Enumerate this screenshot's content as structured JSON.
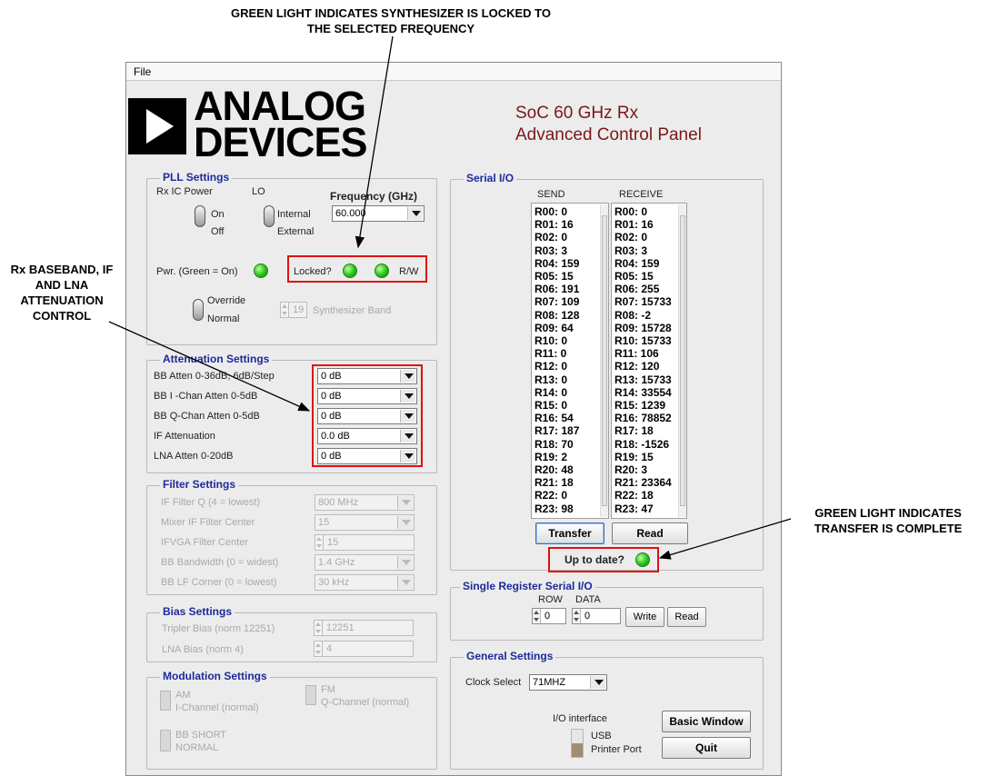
{
  "callouts": {
    "top": "GREEN LIGHT INDICATES SYNTHESIZER IS LOCKED TO THE SELECTED FREQUENCY",
    "left": "Rx BASEBAND, IF AND LNA ATTENUATION CONTROL",
    "right": "GREEN LIGHT INDICATES TRANSFER IS COMPLETE"
  },
  "menu": {
    "file": "File"
  },
  "logo": {
    "line1": "ANALOG",
    "line2": "DEVICES"
  },
  "app_title": {
    "line1": "SoC  60 GHz Rx",
    "line2": "Advanced Control Panel"
  },
  "pll": {
    "title": "PLL Settings",
    "rx_ic_power": "Rx IC Power",
    "lo": "LO",
    "frequency_label": "Frequency (GHz)",
    "frequency_value": "60.000",
    "on": "On",
    "off": "Off",
    "internal": "Internal",
    "external": "External",
    "pwr_label": "Pwr. (Green = On)",
    "locked_label": "Locked?",
    "rw_label": "R/W",
    "override": "Override",
    "normal": "Normal",
    "synth_band_value": "19",
    "synth_band_label": "Synthesizer Band"
  },
  "atten": {
    "title": "Attenuation Settings",
    "rows": [
      {
        "label": "BB Atten 0-36dB, 6dB/Step",
        "value": "0 dB"
      },
      {
        "label": "BB I -Chan Atten 0-5dB",
        "value": "0 dB"
      },
      {
        "label": "BB Q-Chan Atten 0-5dB",
        "value": "0 dB"
      },
      {
        "label": "IF Attenuation",
        "value": "0.0 dB"
      },
      {
        "label": "LNA Atten 0-20dB",
        "value": "0 dB"
      }
    ]
  },
  "filter": {
    "title": "Filter Settings",
    "rows": [
      {
        "label": "IF Filter Q (4 = lowest)",
        "value": "800 MHz"
      },
      {
        "label": "Mixer IF Filter Center",
        "value": "15"
      },
      {
        "label": "IFVGA Filter Center",
        "value": "15"
      },
      {
        "label": "BB Bandwidth (0 = widest)",
        "value": "1.4 GHz"
      },
      {
        "label": "BB LF Corner (0 = lowest)",
        "value": "30 kHz"
      }
    ]
  },
  "bias": {
    "title": "Bias Settings",
    "tripler_label": "Tripler Bias (norm 12251)",
    "tripler_value": "12251",
    "lna_label": "LNA Bias (norm 4)",
    "lna_value": "4"
  },
  "modulation": {
    "title": "Modulation Settings",
    "am": "AM",
    "i_channel": "I-Channel (normal)",
    "fm": "FM",
    "q_channel": "Q-Channel (normal)",
    "bb_short": "BB SHORT",
    "normal": "NORMAL"
  },
  "serial": {
    "title": "Serial I/O",
    "send_header": "SEND",
    "receive_header": "RECEIVE",
    "send": [
      "R00: 0",
      "R01: 16",
      "R02: 0",
      "R03: 3",
      "R04: 159",
      "R05: 15",
      "R06: 191",
      "R07: 109",
      "R08: 128",
      "R09: 64",
      "R10: 0",
      "R11: 0",
      "R12: 0",
      "R13: 0",
      "R14: 0",
      "R15: 0",
      "R16: 54",
      "R17: 187",
      "R18: 70",
      "R19: 2",
      "R20: 48",
      "R21: 18",
      "R22: 0",
      "R23: 98"
    ],
    "receive": [
      "R00: 0",
      "R01: 16",
      "R02: 0",
      "R03: 3",
      "R04: 159",
      "R05: 15",
      "R06: 255",
      "R07: 15733",
      "R08: -2",
      "R09: 15728",
      "R10: 15733",
      "R11: 106",
      "R12: 120",
      "R13: 15733",
      "R14: 33554",
      "R15: 1239",
      "R16: 78852",
      "R17: 18",
      "R18: -1526",
      "R19: 15",
      "R20: 3",
      "R21: 23364",
      "R22: 18",
      "R23: 47"
    ],
    "transfer": "Transfer",
    "read": "Read",
    "up_to_date": "Up to date?"
  },
  "single": {
    "title": "Single Register Serial I/O",
    "row_label": "ROW",
    "data_label": "DATA",
    "row_value": "0",
    "data_value": "0",
    "write": "Write",
    "read": "Read"
  },
  "general": {
    "title": "General Settings",
    "clock_label": "Clock Select",
    "clock_value": "71MHZ",
    "io_interface": "I/O interface",
    "usb": "USB",
    "printer_port": "Printer Port",
    "basic_window": "Basic Window",
    "quit": "Quit"
  }
}
